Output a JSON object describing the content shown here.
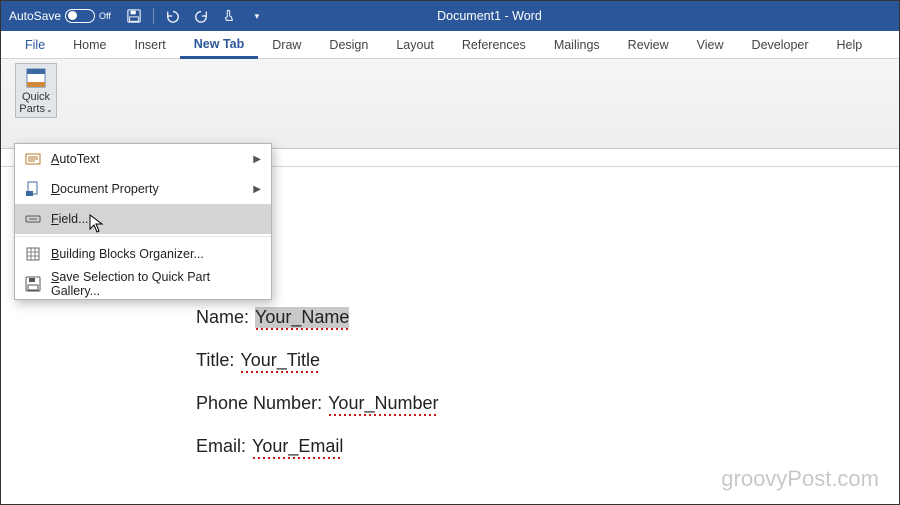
{
  "titlebar": {
    "autosave_label": "AutoSave",
    "autosave_state": "Off",
    "title": "Document1 - Word"
  },
  "tabs": {
    "file": "File",
    "home": "Home",
    "insert": "Insert",
    "newtab": "New Tab",
    "draw": "Draw",
    "design": "Design",
    "layout": "Layout",
    "references": "References",
    "mailings": "Mailings",
    "review": "Review",
    "view": "View",
    "developer": "Developer",
    "help": "Help"
  },
  "ribbon": {
    "quick_parts_line1": "Quick",
    "quick_parts_line2": "Parts"
  },
  "menu": {
    "autotext_u": "A",
    "autotext_rest": "utoText",
    "docprop_u": "D",
    "docprop_rest": "ocument Property",
    "field_u": "F",
    "field_rest": "ield...",
    "bbo_u": "B",
    "bbo_rest": "uilding Blocks Organizer...",
    "save_u": "S",
    "save_rest": "ave Selection to Quick Part Gallery..."
  },
  "doc": {
    "name_label": "Name:",
    "name_value": "Your_Name",
    "title_label": "Title:",
    "title_value": "Your_Title",
    "phone_label": "Phone Number:",
    "phone_value": "Your_Number",
    "email_label": "Email:",
    "email_value": "Your_Email"
  },
  "watermark": "groovyPost.com"
}
